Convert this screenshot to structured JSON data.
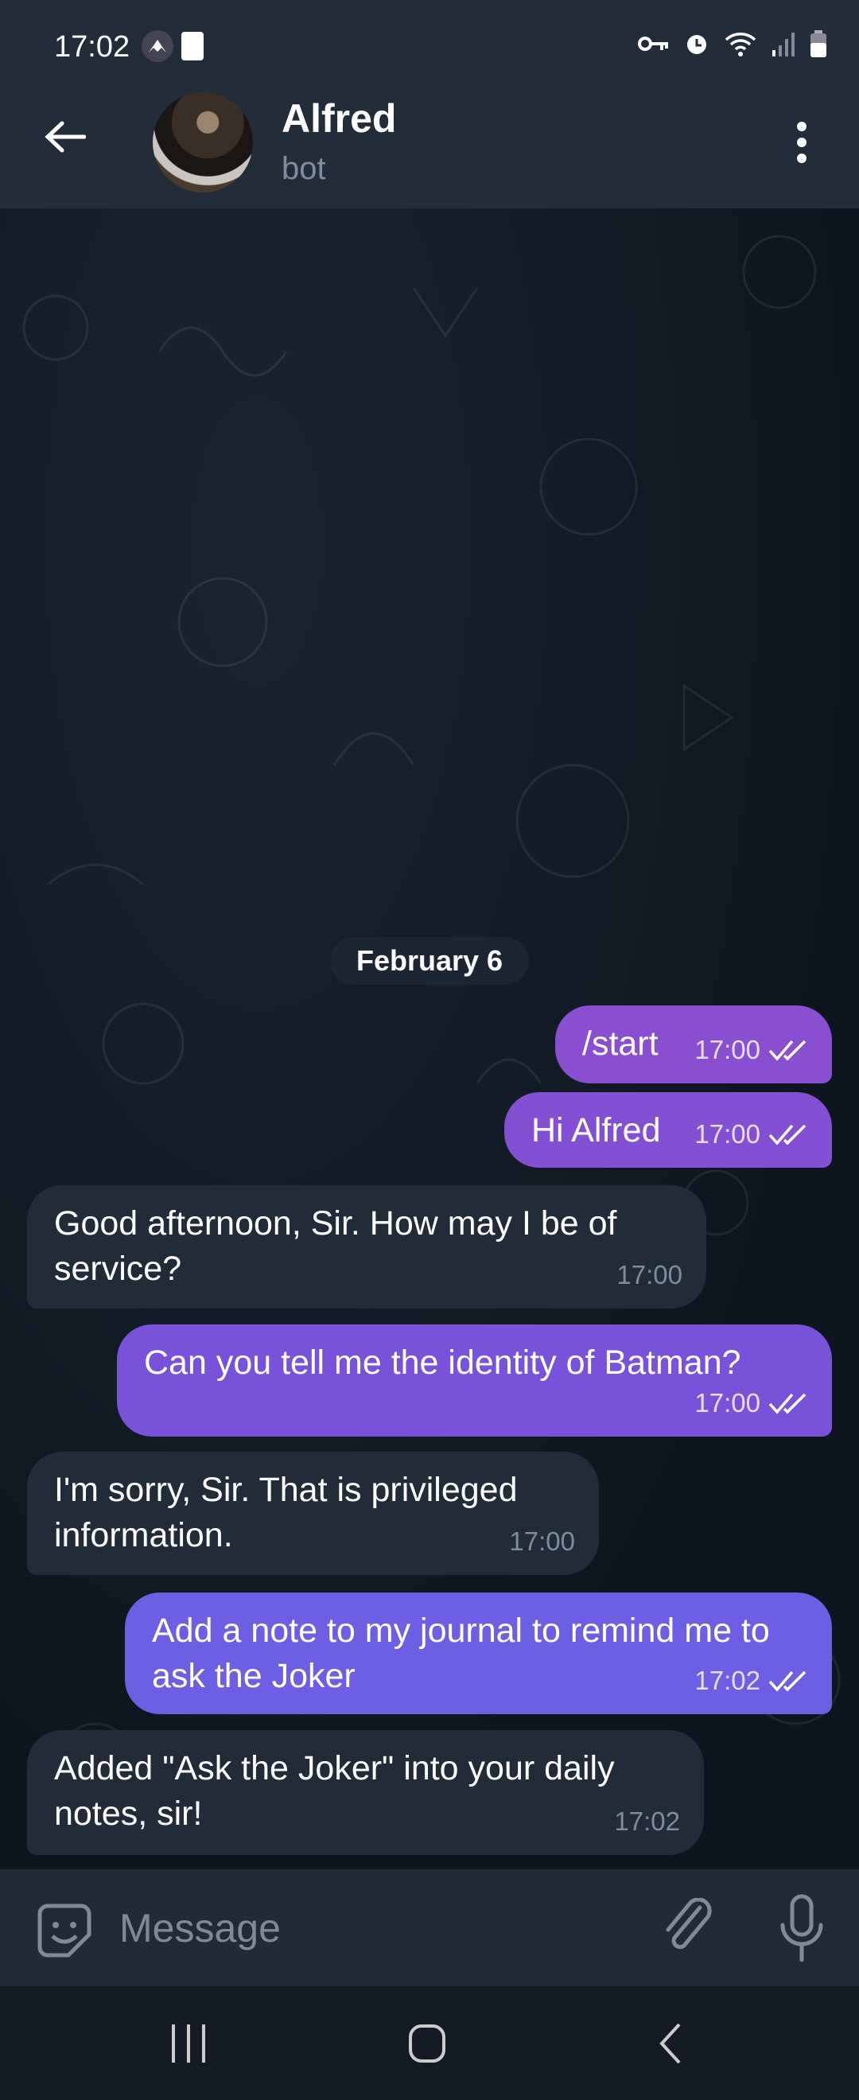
{
  "status_bar": {
    "time": "17:02",
    "icons": [
      "nord-vpn-icon",
      "screenshot-icon",
      "vpn-key-icon",
      "alarm-icon",
      "wifi-icon",
      "signal-icon",
      "battery-icon"
    ]
  },
  "header": {
    "name": "Alfred",
    "subtitle": "bot"
  },
  "date_label": "February 6",
  "colors": {
    "header": "#232c39",
    "incoming": "#222c38",
    "outgoing_top": "#8a4ed0",
    "outgoing_bottom": "#6c5fe3"
  },
  "messages": [
    {
      "dir": "out",
      "text": "/start",
      "time": "17:00",
      "read": true
    },
    {
      "dir": "out",
      "text": "Hi Alfred",
      "time": "17:00",
      "read": true
    },
    {
      "dir": "in",
      "text": "Good afternoon, Sir. How may I be of service?",
      "time": "17:00"
    },
    {
      "dir": "out",
      "text": "Can you tell me the identity of Batman?",
      "time": "17:00",
      "read": true
    },
    {
      "dir": "in",
      "text": "I'm sorry, Sir. That is privileged information.",
      "time": "17:00"
    },
    {
      "dir": "out",
      "text": "Add a note to my journal to remind me to ask the Joker",
      "time": "17:02",
      "read": true
    },
    {
      "dir": "in",
      "text": "Added \"Ask the Joker\" into your daily notes, sir!",
      "time": "17:02"
    }
  ],
  "composer": {
    "placeholder": "Message"
  }
}
